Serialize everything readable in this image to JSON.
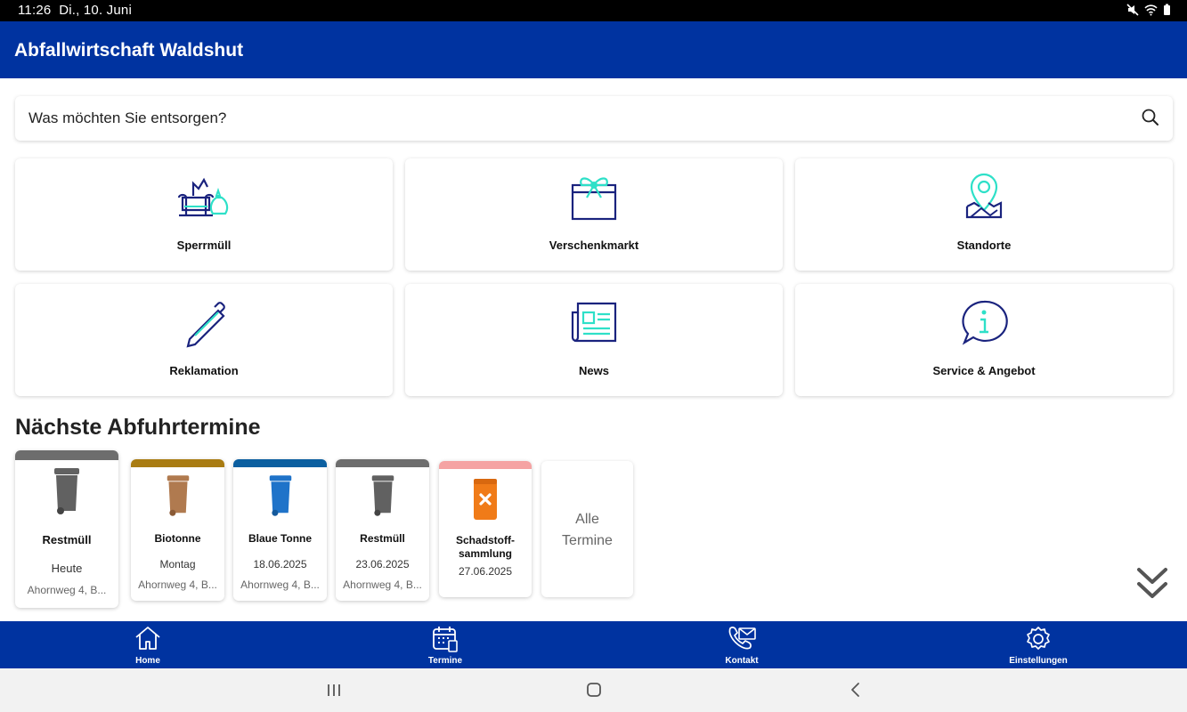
{
  "status_bar": {
    "time": "11:26",
    "date": "Di., 10. Juni",
    "icons": [
      "mute-icon",
      "wifi-icon",
      "battery-icon"
    ]
  },
  "app_bar": {
    "title": "Abfallwirtschaft Waldshut"
  },
  "search": {
    "placeholder": "Was möchten Sie entsorgen?"
  },
  "tiles": [
    {
      "label": "Sperrmüll",
      "icon": "bulky-waste-icon"
    },
    {
      "label": "Verschenkmarkt",
      "icon": "gift-box-icon"
    },
    {
      "label": "Standorte",
      "icon": "location-pin-icon"
    },
    {
      "label": "Reklamation",
      "icon": "pencil-icon"
    },
    {
      "label": "News",
      "icon": "newspaper-icon"
    },
    {
      "label": "Service & Angebot",
      "icon": "info-bubble-icon"
    }
  ],
  "section": {
    "title": "Nächste Abfuhrtermine"
  },
  "pickups": [
    {
      "name": "Restmüll",
      "date": "Heute",
      "address": "Ahornweg 4, B...",
      "color": "#6d6d6d",
      "bin_color": "#616161"
    },
    {
      "name": "Biotonne",
      "date": "Montag",
      "address": "Ahornweg 4, B...",
      "color": "#a97c12",
      "bin_color": "#b07a4f"
    },
    {
      "name": "Blaue Tonne",
      "date": "18.06.2025",
      "address": "Ahornweg 4, B...",
      "color": "#0b5fa0",
      "bin_color": "#1f73c9"
    },
    {
      "name": "Restmüll",
      "date": "23.06.2025",
      "address": "Ahornweg 4, B...",
      "color": "#6d6d6d",
      "bin_color": "#616161"
    },
    {
      "name": "Schadstoff-sammlung",
      "date": "27.06.2025",
      "address": "",
      "color": "#f5a3a3",
      "bin_color": "#f07b18"
    }
  ],
  "all_dates": {
    "label": "Alle Termine"
  },
  "bottom_nav": [
    {
      "label": "Home",
      "icon": "home-icon"
    },
    {
      "label": "Termine",
      "icon": "calendar-icon"
    },
    {
      "label": "Kontakt",
      "icon": "phone-mail-icon"
    },
    {
      "label": "Einstellungen",
      "icon": "gear-icon"
    }
  ],
  "colors": {
    "primary": "#0033a0",
    "accent": "#2ee0c8",
    "icon_dark": "#1a237e"
  }
}
